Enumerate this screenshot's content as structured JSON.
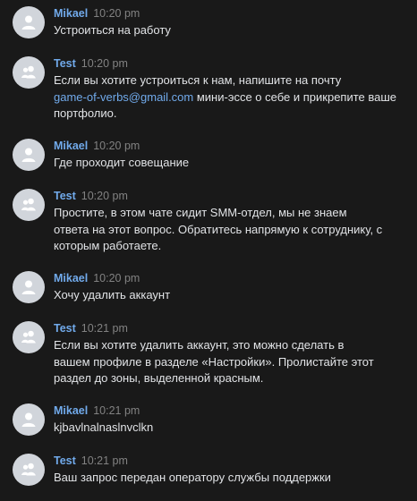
{
  "messages": [
    {
      "author": "Mikael",
      "time": "10:20 pm",
      "avatar": "user-icon",
      "lines": [
        "Устроиться на работу"
      ]
    },
    {
      "author": "Test",
      "time": "10:20 pm",
      "avatar": "group-icon",
      "lines": [
        "Если вы хотите устроиться к нам, напишите на почту"
      ],
      "link": "game-of-verbs@gmail.com",
      "after_link": " мини-эссе о себе и прикрепите ваше",
      "after_lines": [
        "портфолио."
      ]
    },
    {
      "author": "Mikael",
      "time": "10:20 pm",
      "avatar": "user-icon",
      "lines": [
        "Где проходит совещание"
      ]
    },
    {
      "author": "Test",
      "time": "10:20 pm",
      "avatar": "group-icon",
      "lines": [
        "Простите, в этом чате сидит SMM-отдел, мы не знаем",
        "ответа на этот вопрос. Обратитесь напрямую к сотруднику, с",
        "которым работаете."
      ]
    },
    {
      "author": "Mikael",
      "time": "10:20 pm",
      "avatar": "user-icon",
      "lines": [
        "Хочу удалить аккаунт"
      ]
    },
    {
      "author": "Test",
      "time": "10:21 pm",
      "avatar": "group-icon",
      "lines": [
        "Если вы хотите удалить аккаунт, это можно сделать в",
        "вашем профиле в разделе «Настройки». Пролистайте этот",
        "раздел до зоны, выделенной красным."
      ]
    },
    {
      "author": "Mikael",
      "time": "10:21 pm",
      "avatar": "user-icon",
      "lines": [
        "kjbavlnalnaslnvclkn"
      ]
    },
    {
      "author": "Test",
      "time": "10:21 pm",
      "avatar": "group-icon",
      "lines": [
        "Ваш запрос передан оператору службы поддержки"
      ]
    }
  ],
  "colors": {
    "background": "#191919",
    "author": "#71aaeb",
    "link": "#71aaeb",
    "text": "#e1e3e6",
    "time": "#828282",
    "avatar_bg": "#d1d5db",
    "avatar_glyph": "#ffffff"
  }
}
